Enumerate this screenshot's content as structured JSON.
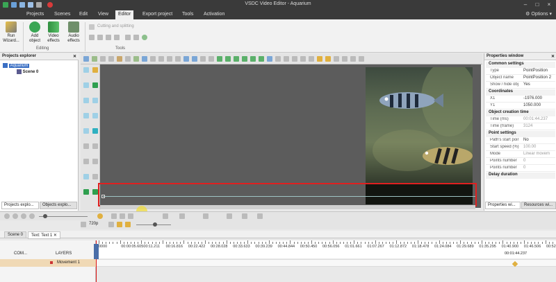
{
  "window": {
    "title": "VSDC Video Editor - Aquarium"
  },
  "menu": {
    "items": [
      "Projects",
      "Scenes",
      "Edit",
      "View",
      "Editor",
      "Export project",
      "Tools",
      "Activation"
    ],
    "active": "Editor",
    "options": "Options"
  },
  "ribbon": {
    "run_wizard": "Run\nWizard...",
    "add_object": "Add\nobject",
    "video_effects": "Video\neffects",
    "audio_effects": "Audio\neffects",
    "cutting": "Cutting and splitting",
    "group_editing": "Editing",
    "group_tools": "Tools"
  },
  "projects_explorer": {
    "title": "Projects explorer",
    "tree": [
      {
        "label": "Aquarium"
      },
      {
        "label": "Scene 0"
      }
    ],
    "tabs": [
      "Projects explo...",
      "Objects explo..."
    ]
  },
  "properties": {
    "title": "Properties window",
    "sections": {
      "common": "Common settings",
      "coordinates": "Coordinates",
      "creation": "Object creation time",
      "point": "Point settings",
      "delay": "Delay duration"
    },
    "rows_common": [
      {
        "k": "Type",
        "v": "PointPosition"
      },
      {
        "k": "Object name",
        "v": "PointPosition 2"
      },
      {
        "k": "Show / hide obj",
        "v": "Yes"
      }
    ],
    "rows_coord": [
      {
        "k": "X1",
        "v": "-1976.000"
      },
      {
        "k": "Y1",
        "v": "1050.000"
      }
    ],
    "rows_time": [
      {
        "k": "Time (ms)",
        "v": "00:01:44.237"
      },
      {
        "k": "Time (frame)",
        "v": "3124"
      }
    ],
    "rows_point": [
      {
        "k": "Path's start poir",
        "v": "No"
      },
      {
        "k": "Start speed (%)",
        "v": "100.00"
      },
      {
        "k": "Mode",
        "v": "Linear movem"
      },
      {
        "k": "Points number",
        "v": "0"
      },
      {
        "k": "Points number",
        "v": "0"
      }
    ],
    "tabs": [
      "Properties wi...",
      "Resources wi..."
    ]
  },
  "playback": {
    "resolution": "720p"
  },
  "timeline": {
    "tabs": [
      "Scene 0",
      "Text: Text 1"
    ],
    "com_label": "COM...",
    "layers_label": "LAYERS",
    "track_label": "Movement 1",
    "cursor_time": "00:01:44.237",
    "ticks": [
      "0000",
      "00:00:05.605",
      "00:11.211",
      "00:16.816",
      "00:22.422",
      "00:28.028",
      "00:33.633",
      "00:39.239",
      "00:44.844",
      "00:50.450",
      "00:56.056",
      "01:01.661",
      "01:07.267",
      "01:12.872",
      "01:18.478",
      "01:24.084",
      "01:29.689",
      "01:35.295",
      "01:40.900",
      "01:46.506",
      "00:52.112"
    ]
  },
  "colors": {
    "accent": "#2f8f3f",
    "red_box": "#e02020",
    "titlebar": "#3a3a3a"
  }
}
